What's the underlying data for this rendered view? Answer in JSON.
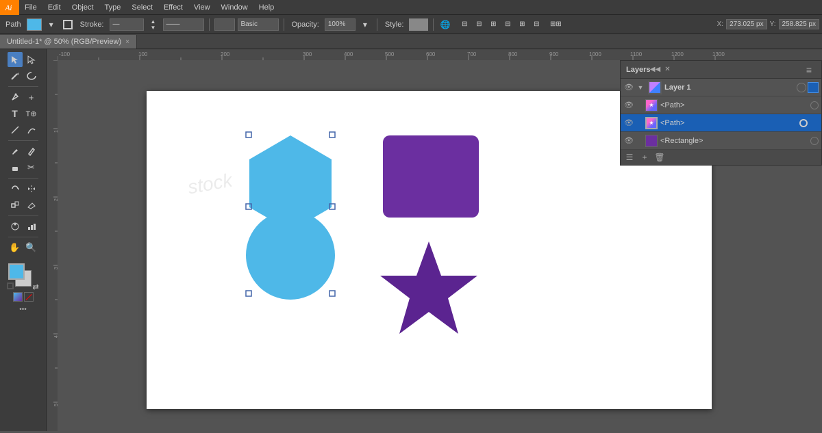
{
  "menubar": {
    "items": [
      "File",
      "Object",
      "Type",
      "Select",
      "Effect",
      "View",
      "Window",
      "Help"
    ]
  },
  "toolbar": {
    "path_label": "Path",
    "stroke_label": "Stroke:",
    "basic_label": "Basic",
    "opacity_label": "Opacity:",
    "opacity_value": "100%",
    "style_label": "Style:",
    "x_label": "X:",
    "x_value": "273.025 px",
    "y_label": "Y:",
    "y_value": "258.825 px"
  },
  "tab": {
    "title": "Untitled-1* @ 50% (RGB/Preview)",
    "close": "×"
  },
  "layers_panel": {
    "title": "Layers",
    "layer1_name": "Layer 1",
    "path1_name": "<Path>",
    "path2_name": "<Path>",
    "rect_name": "<Rectangle>",
    "collapse_btn": "◂◂",
    "close_btn": "×",
    "menu_btn": "≡"
  },
  "canvas": {
    "zoom": "50%",
    "color_mode": "RGB/Preview"
  }
}
